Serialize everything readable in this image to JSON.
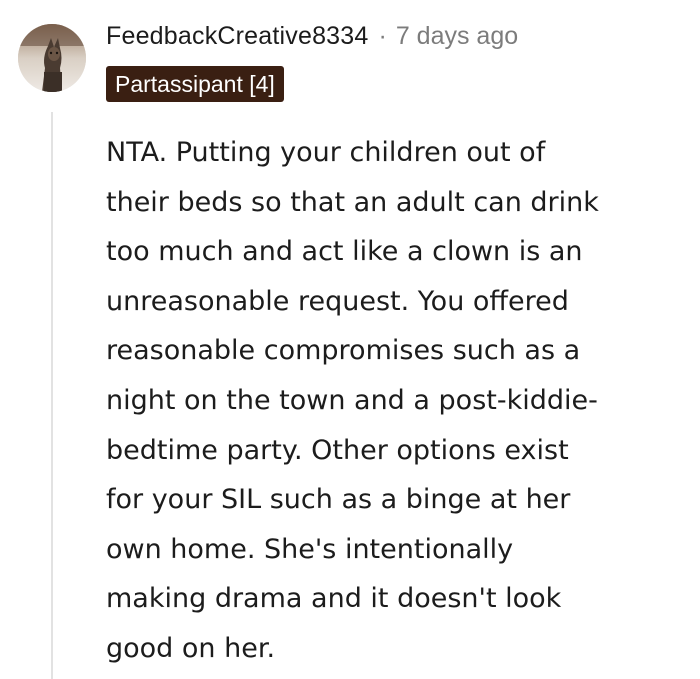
{
  "comment": {
    "username": "FeedbackCreative8334",
    "separator": "·",
    "timestamp": "7 days ago",
    "flair": "Partassipant [4]",
    "body_lines": [
      "NTA. Putting your children out of",
      "their beds so that an adult can drink",
      "too much and act like a clown is an",
      "unreasonable request. You offered",
      "reasonable compromises such as a",
      "night on the town and a post-kiddie-",
      "bedtime party. Other options exist",
      "for your SIL such as a binge at her",
      "own home. She's intentionally",
      "making drama and it doesn't look",
      "good on her."
    ]
  },
  "colors": {
    "flair_background": "#3a1f12",
    "flair_text": "#ffffff",
    "meta_gray": "#7c7c7c",
    "body_text": "#1c1c1c",
    "thread_line": "#e2e2e2"
  },
  "icons": {
    "avatar": "user-avatar-photo"
  }
}
